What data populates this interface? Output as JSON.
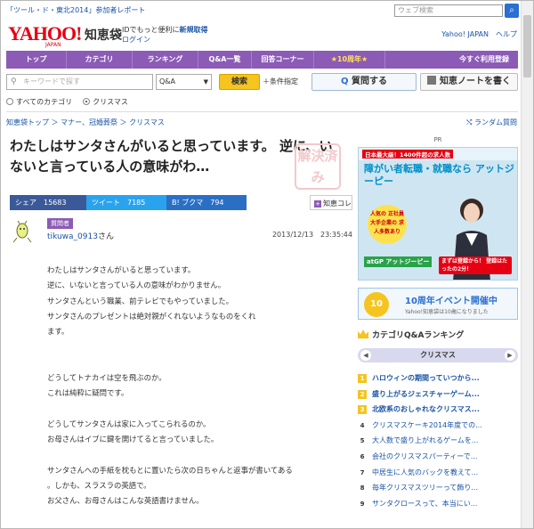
{
  "header": {
    "top_link": "「ツール・ド・東北2014」参加者レポート",
    "top_search_placeholder": "ウェブ検索",
    "logo_text": "YAHOO!",
    "logo_sub": "JAPAN",
    "service_name": "知恵袋",
    "id_note_prefix": "IDでもっと便利に",
    "id_register": "新規取得",
    "login": "ログイン",
    "right_links": "Yahoo! JAPAN　ヘルプ"
  },
  "nav": {
    "items": [
      "トップ",
      "カテゴリ",
      "ランキング",
      "Q&A一覧",
      "回答コーナー",
      "★10周年★",
      "今すぐ利用登録"
    ]
  },
  "search": {
    "keyword_placeholder": "キーワードで探す",
    "type_select": "Q&A",
    "search_button": "検索",
    "conditions": "＋条件指定",
    "ask_button_q": "Q",
    "ask_button": "質問する",
    "note_button": "知恵ノートを書く",
    "scope_all": "すべてのカテゴリ",
    "scope_cat": "クリスマス"
  },
  "breadcrumb": "知恵袋トップ ＞ マナー、冠婚葬祭 ＞ クリスマス",
  "random_link": "ランダム質問",
  "question": {
    "title": "わたしはサンタさんがいると思っています。 逆に、いないと言っている人の意味がわ…",
    "stamp": "解決済み",
    "share_fb": "シェア　15683",
    "share_tw": "ツイート　7185",
    "share_hb": "B! ブクマ　794",
    "note_button": "知恵コレ",
    "asker_badge": "質問者",
    "asker_name": "tikuwa_0913",
    "asker_suffix": "さん",
    "date": "2013/12/13　23:35:44",
    "body": "わたしはサンタさんがいると思っています。\n逆に、いないと言っている人の意味がわかりません。\nサンタさんという職業、前テレビでもやっていました。\nサンタさんのプレゼントは絶対親がくれないようなものをくれ\nます。\n\n\nどうしてトナカイは空を飛ぶのか。\nこれは純粋に疑問です。\n\nどうしてサンタさんは家に入ってこられるのか。\nお母さんはイブに鍵を開けてると言っていました。\n\nサンタさんへの手紙を枕もとに置いたら次の日ちゃんと返事が書いてある\n。しかも、スラスラの英語で。\nお父さん、お母さんはこんな英語書けません。"
  },
  "sidebar": {
    "pr": "PR",
    "ad": {
      "tag": "日本最大級！1400件超の求人数",
      "headline": "障がい者転職・就職なら アットジーピー",
      "badge": "人気の 正社員 大手企業の 求人多数あり",
      "brand": "atGP アットジーピー",
      "cta": "まずは登録から！ 登録はたったの2分！"
    },
    "anniv": {
      "badge": "10",
      "title": "10周年イベント開催中",
      "sub": "Yahoo!知恵袋は10歳になりました"
    },
    "ranking_title": "カテゴリQ&Aランキング",
    "category": "クリスマス",
    "ranking": [
      {
        "num": "1",
        "text": "ハロウィンの期間っていつから..."
      },
      {
        "num": "2",
        "text": "盛り上がるジェスチャーゲーム..."
      },
      {
        "num": "3",
        "text": "北欧系のおしゃれなクリスマス..."
      },
      {
        "num": "4",
        "text": "クリスマスケーキ2014年度での..."
      },
      {
        "num": "5",
        "text": "大人数で盛り上がれるゲームを..."
      },
      {
        "num": "6",
        "text": "会社のクリスマスパーティーで..."
      },
      {
        "num": "7",
        "text": "中居生に人気のバックを教えて..."
      },
      {
        "num": "8",
        "text": "毎年クリスマスツリーって飾り..."
      },
      {
        "num": "9",
        "text": "サンタクロースって、本当にい..."
      }
    ]
  },
  "colors": {
    "nav_purple": "#8b5bb6",
    "link_blue": "#1a53a6",
    "yahoo_red": "#e60012",
    "search_yellow": "#f5c41e"
  }
}
